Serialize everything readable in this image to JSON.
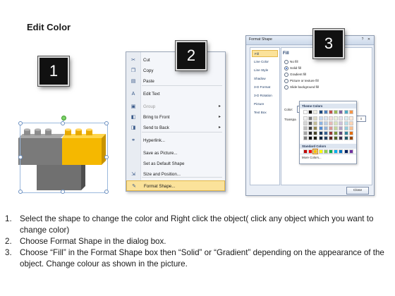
{
  "title": "Edit Color",
  "badges": [
    "1",
    "2",
    "3"
  ],
  "context_menu": {
    "items": [
      {
        "label": "Cut",
        "icon": "scissors-icon",
        "glyph": "✂"
      },
      {
        "label": "Copy",
        "icon": "copy-icon",
        "glyph": "❐"
      },
      {
        "label": "Paste",
        "icon": "paste-icon",
        "glyph": "▤"
      },
      {
        "label": "Edit Text",
        "icon": "edit-text-icon",
        "glyph": "A"
      },
      {
        "label": "Group",
        "icon": "group-icon",
        "glyph": "▣",
        "disabled": true,
        "submenu": true
      },
      {
        "label": "Bring to Front",
        "icon": "bring-front-icon",
        "glyph": "◧",
        "submenu": true
      },
      {
        "label": "Send to Back",
        "icon": "send-back-icon",
        "glyph": "◨",
        "submenu": true
      },
      {
        "label": "Hyperlink...",
        "icon": "hyperlink-icon",
        "glyph": "⚭"
      },
      {
        "label": "Save as Picture...",
        "icon": "",
        "glyph": ""
      },
      {
        "label": "Set as Default Shape",
        "icon": "",
        "glyph": ""
      },
      {
        "label": "Size and Position...",
        "icon": "size-position-icon",
        "glyph": "⇲"
      },
      {
        "label": "Format Shape...",
        "icon": "format-shape-icon",
        "glyph": "✎",
        "highlighted": true
      }
    ]
  },
  "dialog": {
    "title": "Format Shape",
    "nav": [
      "Fill",
      "Line Color",
      "Line Style",
      "Shadow",
      "3-D Format",
      "3-D Rotation",
      "Picture",
      "Text Box"
    ],
    "nav_selected": "Fill",
    "pane_title": "Fill",
    "options": [
      "No fill",
      "Solid fill",
      "Gradient fill",
      "Picture or texture fill",
      "Slide background fill"
    ],
    "selected_option": "Solid fill",
    "color_label": "Color:",
    "transparency_label": "Transpa",
    "close_button": "Close"
  },
  "palette": {
    "theme_header": "Theme Colors",
    "standard_header": "Standard Colors",
    "more_colors": "More Colors...",
    "theme_top": [
      "#ffffff",
      "#000000",
      "#eeece1",
      "#1f497d",
      "#4f81bd",
      "#c0504d",
      "#9bbb59",
      "#8064a2",
      "#4bacc6",
      "#f79646"
    ],
    "theme_shades": [
      [
        "#f2f2f2",
        "#7f7f7f",
        "#ddd9c3",
        "#c6d9f0",
        "#dbe5f1",
        "#f2dcdb",
        "#ebf1dd",
        "#e5e0ec",
        "#dbeef3",
        "#fdeada"
      ],
      [
        "#d8d8d8",
        "#595959",
        "#c4bd97",
        "#8db3e2",
        "#b8cce4",
        "#e5b9b7",
        "#d7e3bc",
        "#ccc1d9",
        "#b7dde8",
        "#fbd5b5"
      ],
      [
        "#bfbfbf",
        "#3f3f3f",
        "#938953",
        "#548dd4",
        "#95b3d7",
        "#d99694",
        "#c3d69b",
        "#b2a2c7",
        "#92cddc",
        "#fac08f"
      ],
      [
        "#a5a5a5",
        "#262626",
        "#494429",
        "#17365d",
        "#366092",
        "#953734",
        "#76923c",
        "#5f497a",
        "#31859b",
        "#e36c09"
      ],
      [
        "#7f7f7f",
        "#0c0c0c",
        "#1d1b10",
        "#0f243e",
        "#244061",
        "#632423",
        "#4f6128",
        "#3f3151",
        "#205867",
        "#974806"
      ]
    ],
    "standard": [
      "#c00000",
      "#ff0000",
      "#ffc000",
      "#ffff00",
      "#92d050",
      "#00b050",
      "#00b0f0",
      "#0070c0",
      "#002060",
      "#7030a0"
    ]
  },
  "lego_colors": {
    "gray": "#808080",
    "yellow": "#f5b800"
  },
  "steps": [
    {
      "num": "1.",
      "text": "Select the shape to change the color and Right click the object( click any object which you want to change color)"
    },
    {
      "num": "2.",
      "text": "Choose Format Shape in the dialog box."
    },
    {
      "num": "3.",
      "text": "Choose “Fill” in the Format Shape box then “Solid” or “Gradient” depending on the appearance of the object. Change colour as shown in the picture."
    }
  ]
}
